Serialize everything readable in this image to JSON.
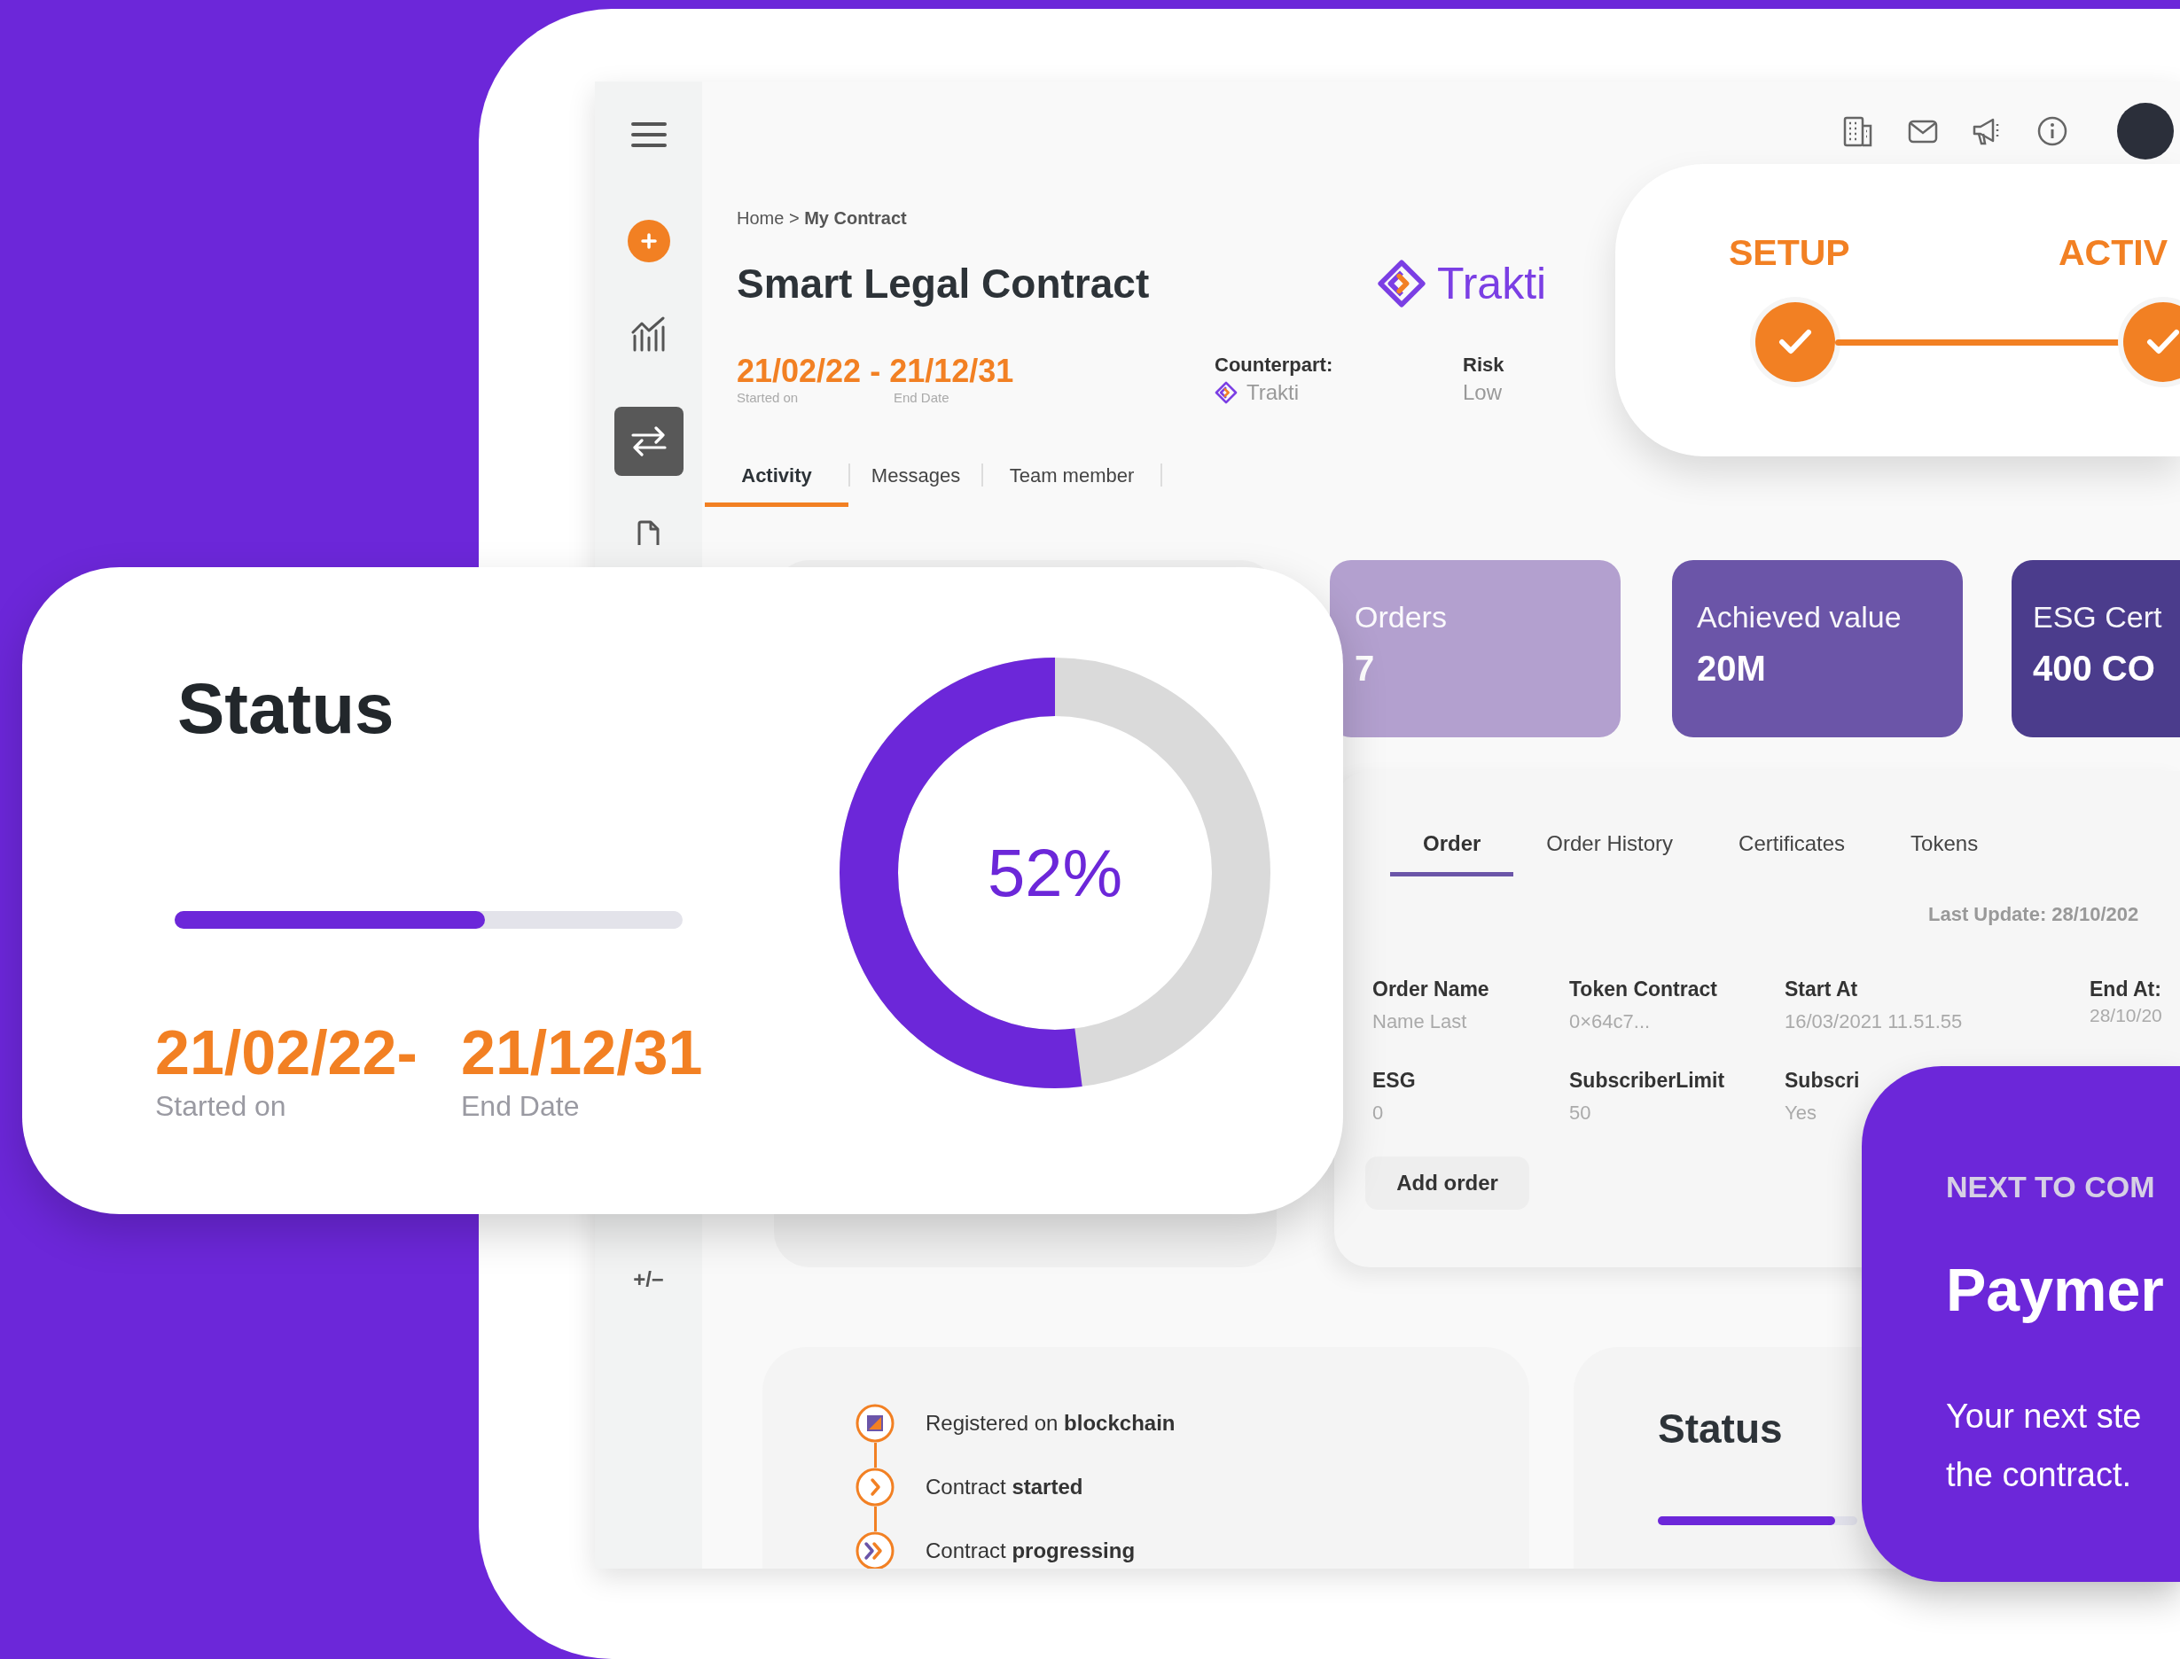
{
  "sidebar": {
    "items": [
      {
        "kind": "menu",
        "selected": false
      },
      {
        "kind": "add",
        "selected": false
      },
      {
        "kind": "chart",
        "selected": false
      },
      {
        "kind": "swap",
        "selected": true
      },
      {
        "kind": "document",
        "selected": false
      }
    ],
    "footer": "+/−"
  },
  "breadcrumb": "Home > **My Contract**",
  "title": "Smart Legal Contract",
  "logo": "Trakti",
  "period": {
    "dates": "21/02/22 - 21/12/31",
    "start_label": "Started on",
    "end_label": "End Date"
  },
  "counterpart": {
    "label": "Counterpart:",
    "value": "Trakti"
  },
  "risk": {
    "label": "Risk",
    "value": "Low"
  },
  "tabs": [
    {
      "label": "Activity",
      "selected": true
    },
    {
      "label": "Messages",
      "selected": false
    },
    {
      "label": "Team member",
      "selected": false
    }
  ],
  "steps": [
    {
      "label": "SETUP",
      "done": true
    },
    {
      "label": "ACTIV",
      "done": true
    }
  ],
  "stat_cards": [
    {
      "label": "Orders",
      "value": "7",
      "color": "#b3a0cf"
    },
    {
      "label": "Achieved value",
      "value": "20M",
      "color": "#6b55a8"
    },
    {
      "label": "ESG Cert",
      "value": "400 CO",
      "color": "#4b3c8c"
    }
  ],
  "order_panel": {
    "tabs": [
      {
        "label": "Order",
        "selected": true
      },
      {
        "label": "Order History",
        "selected": false
      },
      {
        "label": "Certificates",
        "selected": false
      },
      {
        "label": "Tokens",
        "selected": false
      }
    ],
    "last_update": "Last Update: 28/10/202",
    "fields": [
      {
        "label": "Order Name",
        "value": "Name Last"
      },
      {
        "label": "Token Contract",
        "value": "0×64c7..."
      },
      {
        "label": "Start At",
        "value": "16/03/2021 11.51.55"
      },
      {
        "label": "End At:",
        "value": "28/10/20"
      },
      {
        "label": "ESG",
        "value": "0"
      },
      {
        "label": "SubscriberLimit",
        "value": "50"
      },
      {
        "label": "Subscri",
        "value": "Yes"
      }
    ],
    "button": "Add order"
  },
  "activity": [
    {
      "kind": "blockchain",
      "text": "Registered on **blockchain**"
    },
    {
      "kind": "started",
      "text": "Contract **started**"
    },
    {
      "kind": "progressing",
      "text": "Contract **progressing**"
    }
  ],
  "status_small": {
    "title": "Status",
    "level": 0.89
  },
  "next_card": {
    "eyebrow": "NEXT TO COM",
    "title": "Paymer",
    "lines": [
      "Your next ste",
      "the contract."
    ]
  },
  "status_card": {
    "title": "Status",
    "level": 0.61,
    "start": "21/02/22-",
    "end": "21/12/31",
    "start_label": "Started on",
    "end_label": "End Date",
    "donut": {
      "level": 0.52,
      "percent": "52%"
    }
  }
}
